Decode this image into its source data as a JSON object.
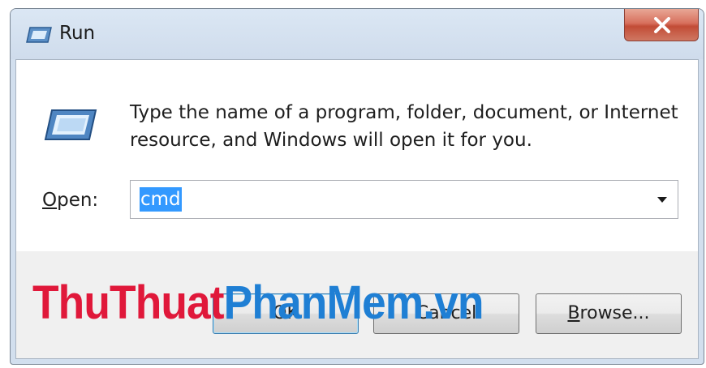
{
  "window": {
    "title": "Run",
    "title_icon": "run-dialog-icon",
    "close_icon": "close-icon"
  },
  "content": {
    "message_line1": "Type the name of a program, folder, document, or Internet",
    "message_line2": "resource, and Windows will open it for you.",
    "open_label_accel": "O",
    "open_label_rest": "pen:",
    "open_value": "cmd",
    "dropdown_icon": "chevron-down-icon"
  },
  "buttons": {
    "ok_label": "OK",
    "cancel_label": "Cancel",
    "browse_accel": "B",
    "browse_rest": "rowse..."
  },
  "watermark": {
    "part1": "ThuThuat",
    "part2": "PhanMem",
    "part3": ".vn"
  },
  "colors": {
    "selection": "#3399ff",
    "watermark_red": "#e0183a",
    "watermark_blue": "#1f7fd4",
    "close_button": "#c24c36"
  }
}
